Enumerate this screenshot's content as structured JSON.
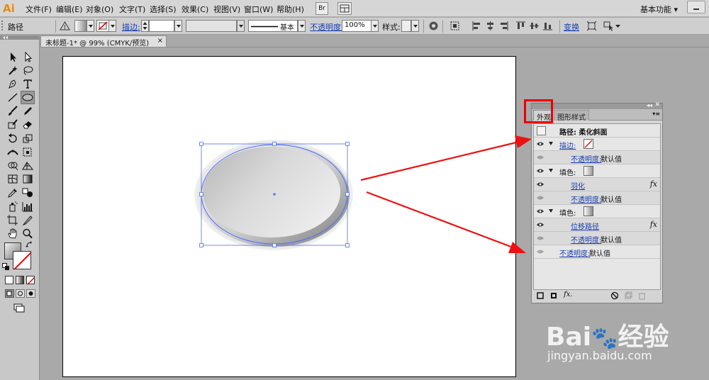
{
  "app": {
    "logo": "Ai",
    "workspace": "基本功能"
  },
  "menu": [
    "文件(F)",
    "编辑(E)",
    "对象(O)",
    "文字(T)",
    "选择(S)",
    "效果(C)",
    "视图(V)",
    "窗口(W)",
    "帮助(H)"
  ],
  "menubar_buttons": {
    "bridge": "Br"
  },
  "controlbar": {
    "object_type": "路径",
    "stroke_label": "描边:",
    "stroke_style": "基本",
    "opacity_label": "不透明度:",
    "opacity_value": "100%",
    "style_label": "样式:",
    "transform_label": "变换"
  },
  "document": {
    "tab_title": "未标题-1* @ 99% (CMYK/预览)",
    "close": "×"
  },
  "appearance_panel": {
    "tabs": [
      "外观",
      "图形样式"
    ],
    "header": "路径: 柔化斜面",
    "rows": [
      {
        "type": "stroke",
        "label": "描边:"
      },
      {
        "type": "opacity",
        "label": "不透明度:",
        "value": "默认值"
      },
      {
        "type": "fill",
        "label": "填色:"
      },
      {
        "type": "effect",
        "label": "羽化",
        "fx": "fx"
      },
      {
        "type": "opacity",
        "label": "不透明度:",
        "value": "默认值"
      },
      {
        "type": "fill",
        "label": "填色:"
      },
      {
        "type": "effect",
        "label": "位移路径",
        "fx": "fx"
      },
      {
        "type": "opacity",
        "label": "不透明度:",
        "value": "默认值"
      },
      {
        "type": "opacity",
        "label": "不透明度:",
        "value": "默认值"
      }
    ],
    "footer_fx": "fx."
  },
  "watermark": {
    "brand": "Bai",
    "brand_cn": "经验",
    "url": "jingyan.baidu.com"
  },
  "colors": {
    "accent": "#e88a12",
    "link": "#1a3fb0",
    "highlight": "#e00000",
    "arrow": "#ee1111",
    "selection": "#4a6cff"
  }
}
